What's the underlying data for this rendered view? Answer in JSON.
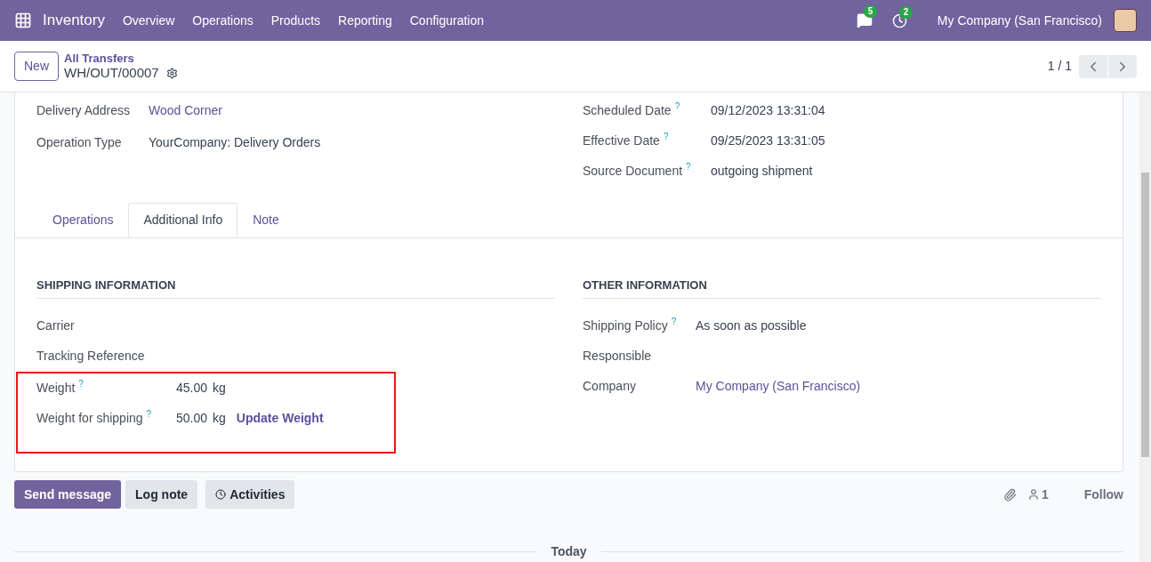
{
  "navbar": {
    "app": "Inventory",
    "menu": [
      "Overview",
      "Operations",
      "Products",
      "Reporting",
      "Configuration"
    ],
    "messages_badge": "5",
    "activities_badge": "2",
    "company": "My Company (San Francisco)"
  },
  "control_panel": {
    "new_button": "New",
    "breadcrumb": "All Transfers",
    "record": "WH/OUT/00007",
    "pager": "1 / 1"
  },
  "header_fields": {
    "left": [
      {
        "label": "Delivery Address",
        "value": "Wood Corner",
        "kind": "link"
      },
      {
        "label": "Operation Type",
        "value": "YourCompany: Delivery Orders",
        "kind": "text"
      }
    ],
    "right": [
      {
        "label": "Scheduled Date",
        "help": "?",
        "value": "09/12/2023 13:31:04",
        "kind": "text"
      },
      {
        "label": "Effective Date",
        "help": "?",
        "value": "09/25/2023 13:31:05",
        "kind": "text"
      },
      {
        "label": "Source Document",
        "help": "?",
        "value": "outgoing shipment",
        "kind": "text"
      }
    ]
  },
  "tabs": [
    {
      "label": "Operations",
      "selected": false
    },
    {
      "label": "Additional Info",
      "selected": true
    },
    {
      "label": "Note",
      "selected": false
    }
  ],
  "sections": [
    {
      "title": "SHIPPING INFORMATION",
      "fields": [
        {
          "label": "Carrier",
          "highlighted": false
        },
        {
          "label": "Tracking Reference",
          "highlighted": false
        },
        {
          "label": "Weight",
          "help": "?",
          "value": "45.00",
          "unit": "kg",
          "kind": "text",
          "highlighted": true
        },
        {
          "label": "Weight for shipping",
          "help": "?",
          "value": "50.00",
          "unit": "kg",
          "kind": "text",
          "action": "Update Weight",
          "highlighted": true
        }
      ]
    },
    {
      "title": "OTHER INFORMATION",
      "fields": [
        {
          "label": "Shipping Policy",
          "help": "?",
          "value": "As soon as possible",
          "kind": "text",
          "highlighted": false
        },
        {
          "label": "Responsible",
          "highlighted": false
        },
        {
          "label": "Company",
          "value": "My Company (San Francisco)",
          "kind": "link",
          "highlighted": false
        }
      ]
    }
  ],
  "chatter": {
    "buttons": [
      {
        "label": "Send message",
        "kind": "primary"
      },
      {
        "label": "Log note",
        "kind": "secondary"
      },
      {
        "label": "Activities",
        "kind": "activities"
      }
    ],
    "followers": "1",
    "follow": "Follow",
    "separator": "Today"
  }
}
